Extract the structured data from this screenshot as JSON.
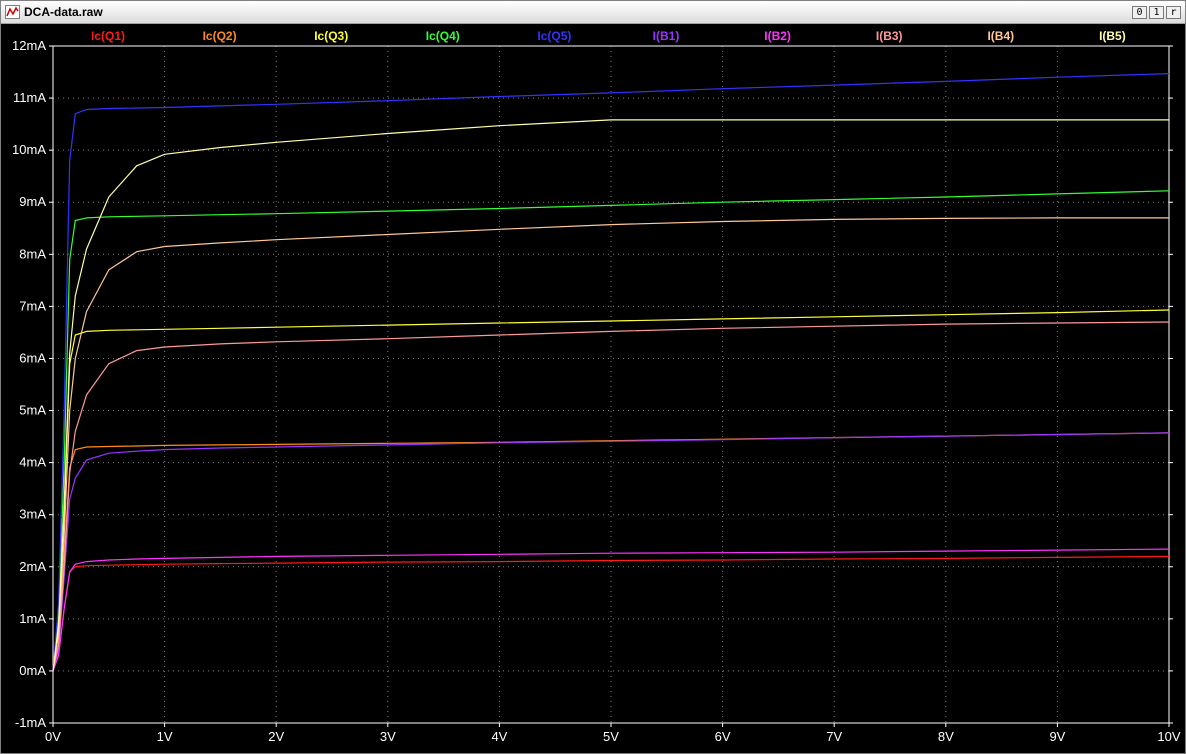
{
  "window": {
    "title": "DCA-data.raw",
    "buttons": [
      "0",
      "1",
      "r"
    ]
  },
  "chart_data": {
    "type": "line",
    "xlabel": "",
    "ylabel": "",
    "xlim": [
      0,
      10
    ],
    "ylim": [
      -1,
      12
    ],
    "x_ticks": [
      "0V",
      "1V",
      "2V",
      "3V",
      "4V",
      "5V",
      "6V",
      "7V",
      "8V",
      "9V",
      "10V"
    ],
    "y_ticks": [
      "12mA",
      "11mA",
      "10mA",
      "9mA",
      "8mA",
      "7mA",
      "6mA",
      "5mA",
      "4mA",
      "3mA",
      "2mA",
      "1mA",
      "0mA",
      "-1mA"
    ],
    "grid": true,
    "legend_placement": "top",
    "x": [
      0,
      0.05,
      0.1,
      0.15,
      0.2,
      0.3,
      0.5,
      0.75,
      1,
      1.5,
      2,
      3,
      4,
      5,
      6,
      7,
      8,
      9,
      10
    ],
    "series": [
      {
        "name": "Ic(Q1)",
        "color": "#ff1a1a",
        "values": [
          0,
          0.3,
          1.2,
          1.9,
          2.0,
          2.02,
          2.03,
          2.04,
          2.05,
          2.06,
          2.07,
          2.09,
          2.1,
          2.12,
          2.13,
          2.15,
          2.16,
          2.18,
          2.2
        ]
      },
      {
        "name": "Ic(Q2)",
        "color": "#ff8c1a",
        "values": [
          0,
          0.5,
          2.2,
          3.9,
          4.25,
          4.3,
          4.31,
          4.32,
          4.33,
          4.34,
          4.35,
          4.37,
          4.39,
          4.42,
          4.45,
          4.48,
          4.51,
          4.54,
          4.57
        ]
      },
      {
        "name": "Ic(Q3)",
        "color": "#ffff33",
        "values": [
          0,
          0.8,
          3.0,
          5.9,
          6.45,
          6.52,
          6.54,
          6.55,
          6.56,
          6.58,
          6.6,
          6.64,
          6.68,
          6.72,
          6.76,
          6.8,
          6.84,
          6.88,
          6.93
        ]
      },
      {
        "name": "Ic(Q4)",
        "color": "#33ff33",
        "values": [
          0,
          1.0,
          4.0,
          7.9,
          8.65,
          8.7,
          8.72,
          8.73,
          8.74,
          8.76,
          8.78,
          8.83,
          8.88,
          8.94,
          9.0,
          9.05,
          9.1,
          9.16,
          9.22
        ]
      },
      {
        "name": "Ic(Q5)",
        "color": "#3333ff",
        "values": [
          0,
          1.3,
          5.0,
          9.8,
          10.7,
          10.78,
          10.8,
          10.81,
          10.82,
          10.85,
          10.88,
          10.95,
          11.03,
          11.1,
          11.18,
          11.25,
          11.32,
          11.4,
          11.47
        ]
      },
      {
        "name": "I(B1)",
        "color": "#9933ff",
        "values": [
          0,
          0.4,
          1.8,
          3.3,
          3.7,
          4.05,
          4.18,
          4.22,
          4.25,
          4.28,
          4.3,
          4.34,
          4.38,
          4.41,
          4.44,
          4.48,
          4.51,
          4.54,
          4.57
        ]
      },
      {
        "name": "I(B2)",
        "color": "#ff33ff",
        "values": [
          0,
          0.3,
          1.2,
          1.9,
          2.05,
          2.1,
          2.13,
          2.15,
          2.16,
          2.18,
          2.2,
          2.22,
          2.24,
          2.26,
          2.27,
          2.28,
          2.3,
          2.32,
          2.34
        ]
      },
      {
        "name": "I(B3)",
        "color": "#ff9999",
        "values": [
          0,
          0.5,
          2.0,
          3.8,
          4.6,
          5.3,
          5.9,
          6.15,
          6.22,
          6.28,
          6.32,
          6.38,
          6.45,
          6.52,
          6.58,
          6.62,
          6.66,
          6.68,
          6.7
        ]
      },
      {
        "name": "I(B4)",
        "color": "#ffc899",
        "values": [
          0,
          0.7,
          2.6,
          5.0,
          6.0,
          6.9,
          7.7,
          8.05,
          8.15,
          8.22,
          8.28,
          8.38,
          8.48,
          8.57,
          8.63,
          8.67,
          8.69,
          8.7,
          8.7
        ]
      },
      {
        "name": "I(B5)",
        "color": "#ffffaa",
        "values": [
          0,
          0.9,
          3.2,
          6.1,
          7.2,
          8.1,
          9.1,
          9.7,
          9.92,
          10.05,
          10.15,
          10.32,
          10.47,
          10.58,
          10.58,
          10.58,
          10.58,
          10.58,
          10.58
        ]
      }
    ]
  }
}
